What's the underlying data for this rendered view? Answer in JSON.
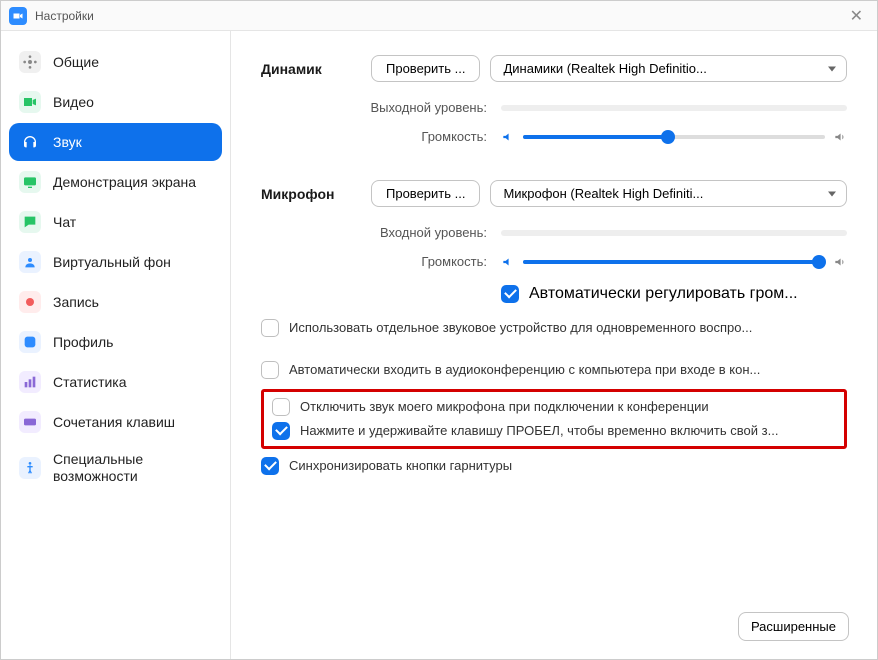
{
  "window": {
    "title": "Настройки"
  },
  "sidebar": {
    "items": [
      {
        "label": "Общие",
        "icon": "gear",
        "color": "#e9e9e9"
      },
      {
        "label": "Видео",
        "icon": "video",
        "color": "#e9e9e9"
      },
      {
        "label": "Звук",
        "icon": "headphones",
        "color": "#ffffff",
        "active": true
      },
      {
        "label": "Демонстрация экрана",
        "icon": "share",
        "color": "#e9e9e9"
      },
      {
        "label": "Чат",
        "icon": "chat",
        "color": "#e9e9e9"
      },
      {
        "label": "Виртуальный фон",
        "icon": "background",
        "color": "#e9e9e9"
      },
      {
        "label": "Запись",
        "icon": "record",
        "color": "#e9e9e9"
      },
      {
        "label": "Профиль",
        "icon": "profile",
        "color": "#e9e9e9"
      },
      {
        "label": "Статистика",
        "icon": "stats",
        "color": "#e9e9e9"
      },
      {
        "label": "Сочетания клавиш",
        "icon": "keyboard",
        "color": "#e9e9e9"
      },
      {
        "label": "Специальные возможности",
        "icon": "access",
        "color": "#e9e9e9"
      }
    ]
  },
  "speaker": {
    "label": "Динамик",
    "test_btn": "Проверить ...",
    "device": "Динамики (Realtek High Definitio...",
    "output_label": "Выходной уровень:",
    "volume_label": "Громкость:",
    "volume_pct": 48
  },
  "mic": {
    "label": "Микрофон",
    "test_btn": "Проверить ...",
    "device": "Микрофон (Realtek High Definiti...",
    "input_label": "Входной уровень:",
    "volume_label": "Громкость:",
    "volume_pct": 98,
    "auto_adjust": "Автоматически регулировать гром..."
  },
  "options": {
    "separate_device": "Использовать отдельное звуковое устройство для одновременного воспро...",
    "auto_join": "Автоматически входить в аудиоконференцию с компьютера при входе в кон...",
    "mute_on_join": "Отключить звук моего микрофона при подключении к конференции",
    "push_to_talk": "Нажмите и удерживайте клавишу ПРОБЕЛ, чтобы временно включить свой з...",
    "sync_headset": "Синхронизировать кнопки гарнитуры"
  },
  "advanced_btn": "Расширенные"
}
